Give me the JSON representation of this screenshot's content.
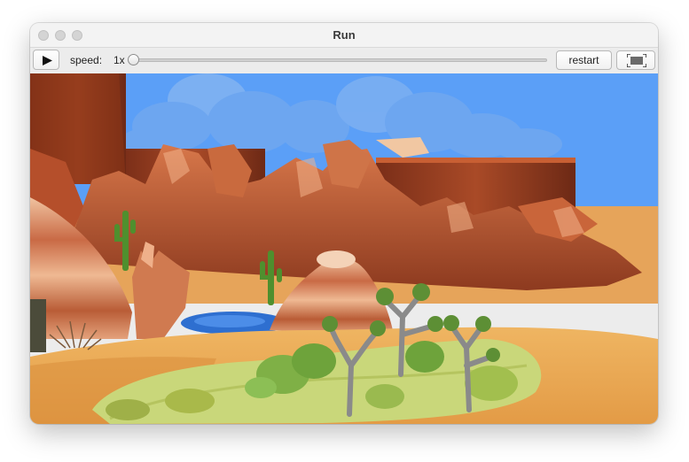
{
  "window": {
    "title": "Run"
  },
  "toolbar": {
    "play_icon": "play-icon",
    "speed_label": "speed:",
    "speed_value": "1x",
    "speed_slider_fraction": 0.0,
    "restart_label": "restart",
    "fullscreen_icon": "fullscreen-icon"
  },
  "scene": {
    "description_icon": "3d-desert-world"
  },
  "colors": {
    "sky": "#5b9ff7",
    "sand": "#e7a24e",
    "rock": "#b8552f",
    "water": "#2e6fd0",
    "grass": "#c9d77a"
  }
}
